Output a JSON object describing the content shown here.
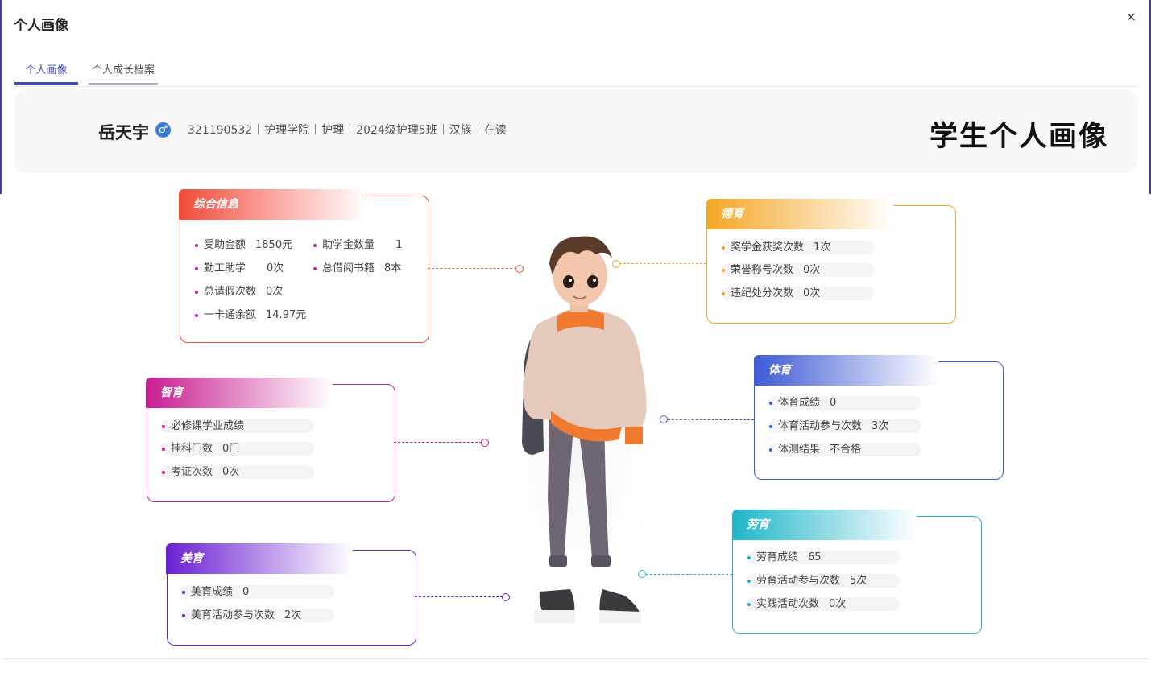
{
  "dialog": {
    "title": "个人画像",
    "close_label": "×"
  },
  "tabs": [
    {
      "label": "个人画像",
      "active": true
    },
    {
      "label": "个人成长档案",
      "active": false
    }
  ],
  "profile": {
    "name": "岳天宇",
    "gender_symbol": "♂",
    "student_id": "321190532",
    "college": "护理学院",
    "major": "护理",
    "class": "2024级护理5班",
    "ethnicity": "汉族",
    "status": "在读",
    "page_title": "学生个人画像"
  },
  "cards": {
    "comprehensive": {
      "title": "综合信息",
      "color": "#f24b3a",
      "items": [
        {
          "label": "受助金额",
          "value": "1850元"
        },
        {
          "label": "助学金数量",
          "value": "1"
        },
        {
          "label": "勤工助学",
          "value": "0次"
        },
        {
          "label": "总借阅书籍",
          "value": "8本"
        },
        {
          "label": "总请假次数",
          "value": "0次"
        },
        {
          "label": "一卡通余额",
          "value": "14.97元"
        }
      ]
    },
    "moral": {
      "title": "德育",
      "color": "#f5a623",
      "items": [
        {
          "label": "奖学金获奖次数",
          "value": "1次"
        },
        {
          "label": "荣誉称号次数",
          "value": "0次"
        },
        {
          "label": "违纪处分次数",
          "value": "0次"
        }
      ]
    },
    "intellectual": {
      "title": "智育",
      "color": "#c81d8f",
      "items": [
        {
          "label": "必修课学业成绩",
          "value": ""
        },
        {
          "label": "挂科门数",
          "value": "0门"
        },
        {
          "label": "考证次数",
          "value": "0次"
        }
      ]
    },
    "physical": {
      "title": "体育",
      "color": "#3e5ad6",
      "items": [
        {
          "label": "体育成绩",
          "value": "0"
        },
        {
          "label": "体育活动参与次数",
          "value": "3次"
        },
        {
          "label": "体测结果",
          "value": "不合格"
        }
      ]
    },
    "aesthetic": {
      "title": "美育",
      "color": "#6a1fd0",
      "items": [
        {
          "label": "美育成绩",
          "value": "0"
        },
        {
          "label": "美育活动参与次数",
          "value": "2次"
        }
      ]
    },
    "labor": {
      "title": "劳育",
      "color": "#1fb6c8",
      "items": [
        {
          "label": "劳育成绩",
          "value": "65"
        },
        {
          "label": "劳育活动参与次数",
          "value": "5次"
        },
        {
          "label": "实践活动次数",
          "value": "0次"
        }
      ]
    }
  }
}
